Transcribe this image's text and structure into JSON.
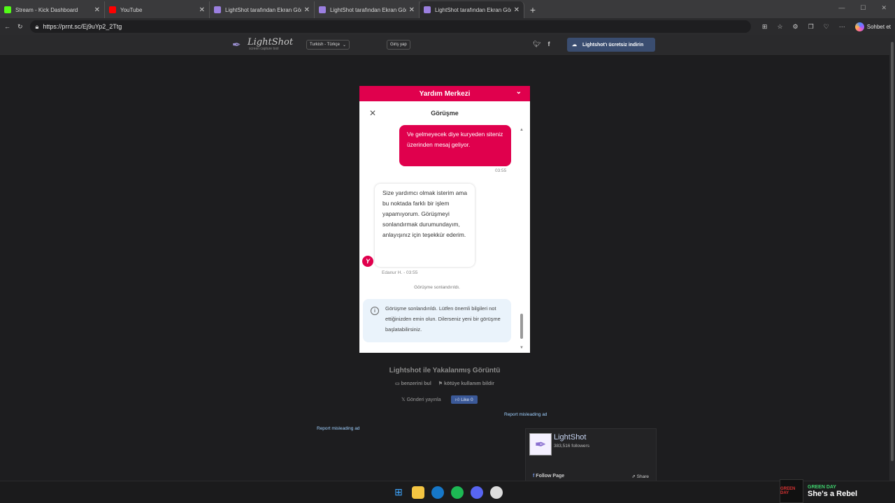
{
  "browser": {
    "tabs": [
      {
        "label": "Stream - Kick Dashboard",
        "icon": "kick-icon",
        "color": "#53fc18"
      },
      {
        "label": "YouTube",
        "icon": "youtube-icon",
        "color": "#ff0000"
      },
      {
        "label": "LightShot tarafından Ekran Görünt",
        "icon": "lightshot-icon",
        "color": "#9b7fe0"
      },
      {
        "label": "LightShot tarafından Ekran Görünt",
        "icon": "lightshot-icon",
        "color": "#9b7fe0"
      },
      {
        "label": "LightShot tarafından Ekran Görünt",
        "icon": "lightshot-icon",
        "color": "#9b7fe0"
      }
    ],
    "url": "https://prnt.sc/Ej9uYp2_2Ttg",
    "copilot_label": "Sohbet et"
  },
  "lightshot": {
    "logo_name": "LightShot",
    "logo_sub": "screen capture tool",
    "language": "Turkish - Türkçe",
    "login": "Giriş yap",
    "download": "Lightshot'ı ücretsiz indirin",
    "caption": "Lightshot ile Yakalanmış Görüntü",
    "find_similar": "benzerini bul",
    "report_abuse": "kötüye kullanım bildir",
    "post": "Gönderi yayınla",
    "like": "Like 0",
    "report_ad": "Report misleading ad"
  },
  "screenshot": {
    "help_center": "Yardım Merkezi",
    "conversation_title": "Görüşme",
    "outgoing_message": "Ve gelmeyecek diye kuryeden siteniz üzerinden mesaj geliyor.",
    "outgoing_time": "03:55",
    "incoming_message": "Size yardımcı olmak isterim ama bu noktada farklı bir işlem yapamıyorum. Görüşmeyi sonlandırmak durumundayım, anlayışınız için teşekkür ederim.",
    "avatar_letter": "Y",
    "incoming_meta": "Edanur H. - 03:55",
    "ended": "Görüşme sonlandırıldı.",
    "notice": "Görüşme sonlandırıldı. Lütfen önemli bilgileri not ettiğinizden emin olun. Dilerseniz yeni bir görüşme başlatabilirsiniz."
  },
  "facebook": {
    "name": "LightShot",
    "followers": "383,516 followers",
    "follow": "Follow Page",
    "share": "Share"
  },
  "media": {
    "artist": "GREEN DAY",
    "title": "She's a Rebel",
    "art_label": "GREEN DAY"
  }
}
